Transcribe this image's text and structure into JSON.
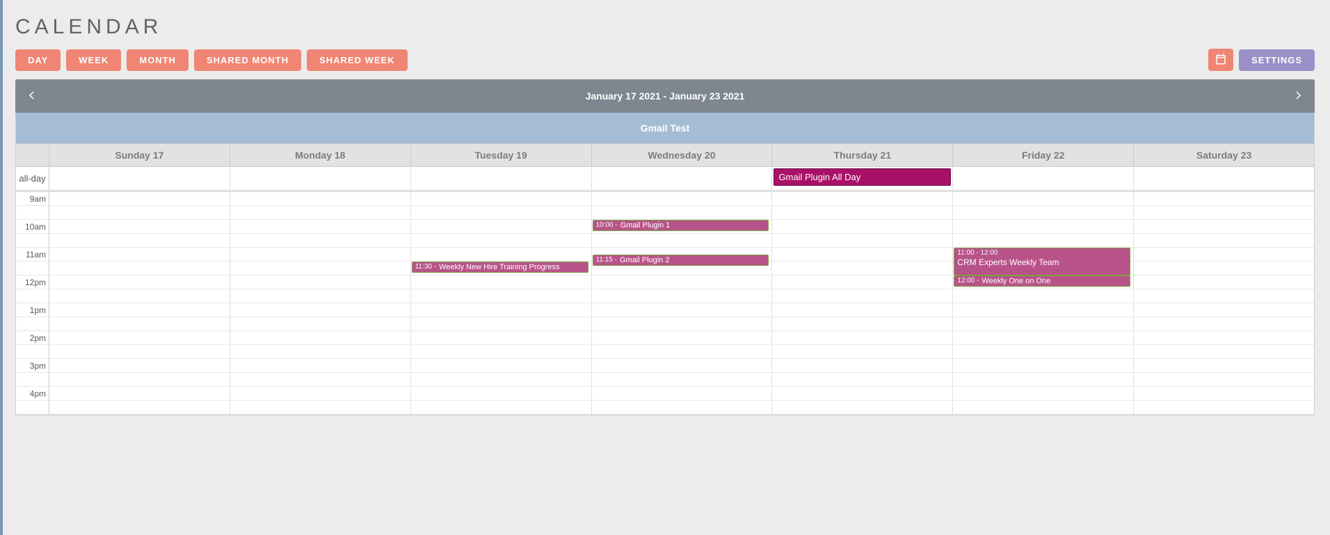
{
  "page_title": "CALENDAR",
  "toolbar": {
    "day": "DAY",
    "week": "WEEK",
    "month": "MONTH",
    "shared_month": "SHARED MONTH",
    "shared_week": "SHARED WEEK",
    "settings": "SETTINGS"
  },
  "date_range": "January 17 2021 - January 23 2021",
  "calendar_name": "Gmail Test",
  "days": [
    "Sunday 17",
    "Monday 18",
    "Tuesday 19",
    "Wednesday 20",
    "Thursday 21",
    "Friday 22",
    "Saturday 23"
  ],
  "allday_label": "all-day",
  "time_labels": [
    "9am",
    "",
    "10am",
    "",
    "11am",
    "",
    "12pm",
    "",
    "1pm",
    "",
    "2pm",
    "",
    "3pm",
    "",
    "4pm",
    ""
  ],
  "slot_minutes": 30,
  "grid_start_hour": 9,
  "allday_events": [
    {
      "day_index": 4,
      "title": "Gmail Plugin All Day"
    }
  ],
  "events": [
    {
      "day_index": 3,
      "start": "10:00",
      "duration_min": 15,
      "time_label": "10:00 -",
      "title": "Gmail Plugin 1"
    },
    {
      "day_index": 3,
      "start": "11:15",
      "duration_min": 15,
      "time_label": "11:15 -",
      "title": "Gmail Plugin 2"
    },
    {
      "day_index": 2,
      "start": "11:30",
      "duration_min": 15,
      "time_label": "11:30 -",
      "title": "Weekly New Hire Training Progress"
    },
    {
      "day_index": 5,
      "start": "11:00",
      "duration_min": 60,
      "time_label": "11:00 - 12:00",
      "title": "CRM Experts Weekly Team"
    },
    {
      "day_index": 5,
      "start": "12:00",
      "duration_min": 15,
      "time_label": "12:00 -",
      "title": "Weekly One on One"
    }
  ],
  "colors": {
    "coral": "#f08574",
    "purple": "#9b8fc7",
    "nav_bg": "#7e8790",
    "sub_bg": "#a5bdd4",
    "event_bg": "#b8538a",
    "allday_event_bg": "#a91168"
  }
}
